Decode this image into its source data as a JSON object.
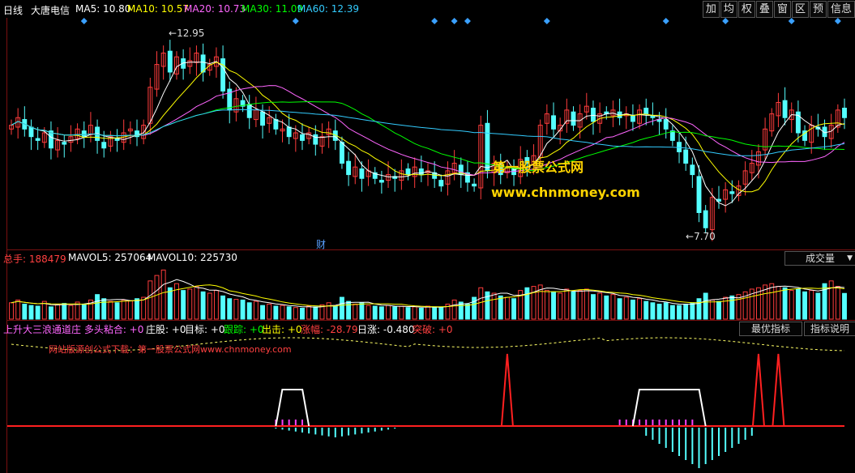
{
  "header": {
    "period": "日线",
    "stock_name": "大唐电信",
    "ma_items": [
      {
        "label": "MA5: 10.80",
        "color": "#ffffff"
      },
      {
        "label": "MA10: 10.57",
        "color": "#ffff00"
      },
      {
        "label": "MA20: 10.73",
        "color": "#ff66ff"
      },
      {
        "label": "MA30: 11.09",
        "color": "#00ff00"
      },
      {
        "label": "MA60: 12.39",
        "color": "#33ccff"
      }
    ],
    "tool_buttons": [
      "加",
      "均",
      "权",
      "叠",
      "窗",
      "区",
      "预",
      "信息"
    ]
  },
  "price_panel": {
    "high_label": "12.95",
    "low_label": "7.70",
    "event_marker": "财",
    "watermark_title": "第一股票公式网",
    "watermark_url": "www.chnmoney.com"
  },
  "volume_panel": {
    "items": [
      {
        "label": "总手: 188479",
        "color": "#ff4040"
      },
      {
        "label": "MAVOL5: 257064",
        "color": "#ffffff"
      },
      {
        "label": "MAVOL10: 225730",
        "color": "#ffffff"
      }
    ],
    "dropdown_label": "成交量"
  },
  "indicator_panel": {
    "items": [
      {
        "label": "上升大三浪通道庄 多头粘合: +0",
        "color": "#ff66ff"
      },
      {
        "label": "庄股: +0",
        "color": "#ffffff"
      },
      {
        "label": "目标: +0",
        "color": "#ffffff"
      },
      {
        "label": "跟踪: +0",
        "color": "#00ff00"
      },
      {
        "label": "出击: +0",
        "color": "#ffff00"
      },
      {
        "label": "涨幅: -28.79",
        "color": "#ff4040"
      },
      {
        "label": "日涨: -0.480",
        "color": "#ffffff"
      },
      {
        "label": "突破: +0",
        "color": "#ff4040"
      }
    ],
    "optimize_button": "最优指标",
    "help_button": "指标说明",
    "inner_watermark": "网站版源创公式下载：第一股票公式网www.chnmoney.com"
  },
  "colors": {
    "up": "#ff3c3c",
    "down": "#54ffff",
    "axis": "#7a1010",
    "ma5": "#ffffff",
    "ma10": "#ffff00",
    "ma20": "#ff66ff",
    "ma30": "#00ff00",
    "ma60": "#33ccff",
    "diamond": "#3aa0ff"
  },
  "chart_data": {
    "type": "candlestick",
    "closes": [
      10.6,
      10.8,
      10.5,
      10.3,
      10.2,
      10.4,
      10.0,
      10.2,
      10.1,
      10.3,
      10.5,
      10.3,
      10.6,
      10.2,
      10.0,
      10.3,
      10.2,
      10.4,
      10.5,
      10.3,
      10.6,
      11.6,
      12.2,
      12.5,
      12.0,
      12.4,
      12.1,
      12.3,
      12.5,
      12.0,
      12.2,
      12.4,
      11.5,
      11.0,
      11.3,
      11.1,
      10.8,
      11.0,
      10.6,
      10.8,
      10.5,
      10.5,
      10.3,
      10.4,
      10.2,
      10.4,
      10.1,
      10.3,
      10.5,
      10.2,
      9.6,
      9.3,
      9.5,
      9.2,
      9.4,
      9.2,
      9.1,
      9.3,
      9.2,
      9.4,
      9.3,
      9.5,
      9.3,
      9.4,
      9.2,
      9.0,
      9.4,
      9.6,
      9.3,
      9.1,
      9.0,
      10.6,
      9.4,
      9.6,
      9.3,
      9.5,
      9.3,
      9.7,
      9.6,
      9.8,
      10.6,
      10.9,
      10.5,
      10.6,
      11.0,
      10.6,
      10.9,
      11.1,
      10.7,
      10.9,
      10.9,
      11.0,
      10.8,
      10.9,
      10.7,
      11.0,
      10.9,
      10.8,
      10.7,
      10.5,
      10.2,
      9.9,
      9.6,
      9.3,
      8.3,
      7.9,
      8.7,
      8.6,
      8.9,
      8.8,
      9.0,
      9.4,
      9.6,
      9.9,
      10.5,
      10.9,
      11.2,
      10.8,
      11.0,
      10.4,
      10.2,
      10.6,
      10.5,
      10.3,
      10.6,
      11.0,
      10.8
    ],
    "volumes": [
      120000,
      140000,
      110000,
      100000,
      95000,
      130000,
      90000,
      105000,
      115000,
      100000,
      125000,
      110000,
      140000,
      180000,
      150000,
      130000,
      120000,
      140000,
      135000,
      150000,
      160000,
      280000,
      320000,
      360000,
      230000,
      260000,
      210000,
      220000,
      240000,
      200000,
      190000,
      210000,
      170000,
      150000,
      145000,
      140000,
      120000,
      130000,
      100000,
      110000,
      95000,
      100000,
      90000,
      85000,
      80000,
      95000,
      90000,
      105000,
      120000,
      95000,
      160000,
      130000,
      110000,
      120000,
      100000,
      95000,
      90000,
      100000,
      90000,
      95000,
      85000,
      90000,
      80000,
      95000,
      90000,
      85000,
      110000,
      140000,
      125000,
      110000,
      160000,
      230000,
      200000,
      190000,
      170000,
      160000,
      150000,
      210000,
      230000,
      240000,
      250000,
      210000,
      200000,
      190000,
      220000,
      200000,
      210000,
      220000,
      180000,
      190000,
      170000,
      180000,
      150000,
      160000,
      140000,
      150000,
      130000,
      120000,
      110000,
      120000,
      100000,
      100000,
      110000,
      120000,
      150000,
      190000,
      140000,
      130000,
      160000,
      170000,
      180000,
      200000,
      220000,
      230000,
      250000,
      260000,
      240000,
      230000,
      210000,
      220000,
      200000,
      210000,
      190000,
      260000,
      280000,
      240000,
      188479
    ]
  }
}
